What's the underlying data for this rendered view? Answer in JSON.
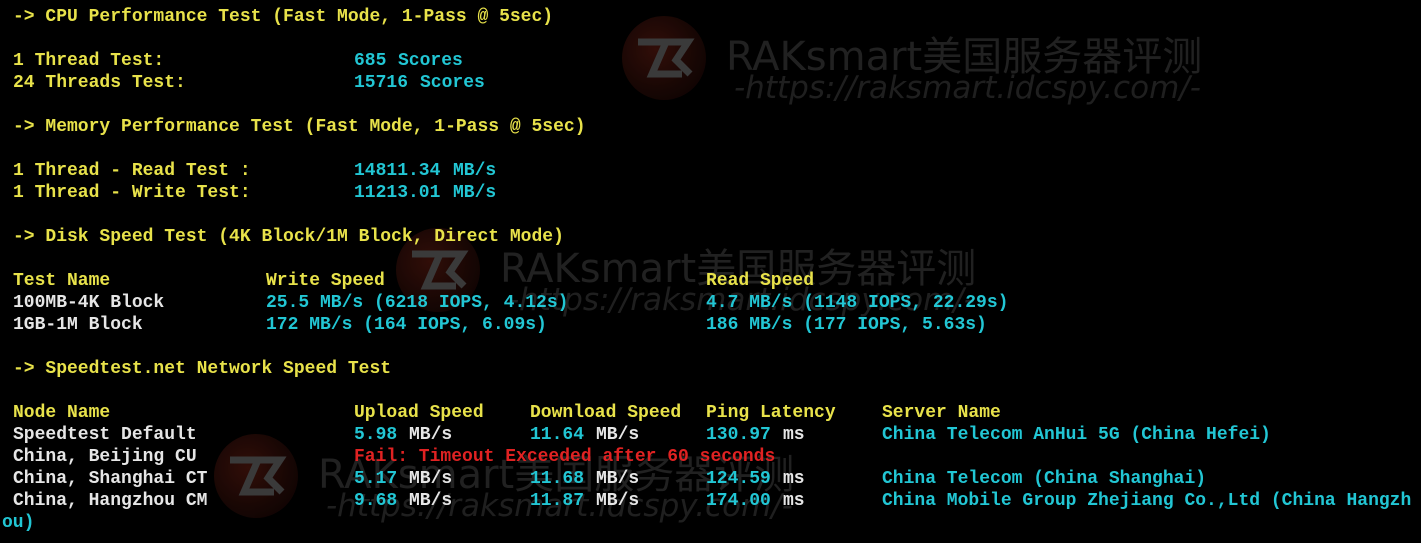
{
  "cpu": {
    "heading": "-> CPU Performance Test (Fast Mode, 1-Pass @ 5sec)",
    "rows": [
      {
        "label": "1 Thread Test:",
        "value": "685",
        "unit": "Scores"
      },
      {
        "label": "24 Threads Test:",
        "value": "15716",
        "unit": "Scores"
      }
    ]
  },
  "memory": {
    "heading": "-> Memory Performance Test (Fast Mode, 1-Pass @ 5sec)",
    "rows": [
      {
        "label": "1 Thread - Read Test :",
        "value": "14811.34",
        "unit": "MB/s"
      },
      {
        "label": "1 Thread - Write Test:",
        "value": "11213.01",
        "unit": "MB/s"
      }
    ]
  },
  "disk": {
    "heading": "-> Disk Speed Test (4K Block/1M Block, Direct Mode)",
    "headers": {
      "name": "Test Name",
      "write": "Write Speed",
      "read": "Read Speed"
    },
    "rows": [
      {
        "name": "100MB-4K Block",
        "write": "25.5 MB/s (6218 IOPS, 4.12s)",
        "read": "4.7 MB/s (1148 IOPS, 22.29s)"
      },
      {
        "name": "1GB-1M Block",
        "write": "172 MB/s (164 IOPS, 6.09s)",
        "read": "186 MB/s (177 IOPS, 5.63s)"
      }
    ]
  },
  "network": {
    "heading": "-> Speedtest.net Network Speed Test",
    "headers": {
      "node": "Node Name",
      "upload": "Upload Speed",
      "download": "Download Speed",
      "ping": "Ping Latency",
      "server": "Server Name"
    },
    "rows": [
      {
        "node": "Speedtest Default",
        "upload": "5.98",
        "upload_unit": "MB/s",
        "download": "11.64",
        "download_unit": "MB/s",
        "ping": "130.97",
        "ping_unit": "ms",
        "server": "China Telecom AnHui 5G (China Hefei)"
      },
      {
        "node": "China, Beijing CU",
        "error": "Fail: Timeout Exceeded after 60 seconds"
      },
      {
        "node": "China, Shanghai CT",
        "upload": "5.17",
        "upload_unit": "MB/s",
        "download": "11.68",
        "download_unit": "MB/s",
        "ping": "124.59",
        "ping_unit": "ms",
        "server": "China Telecom (China Shanghai)"
      },
      {
        "node": "China, Hangzhou CM",
        "upload": "9.68",
        "upload_unit": "MB/s",
        "download": "11.87",
        "download_unit": "MB/s",
        "ping": "174.00",
        "ping_unit": "ms",
        "server": "China Mobile Group Zhejiang Co.,Ltd (China Hangzh"
      }
    ],
    "wrap_line": "ou)"
  },
  "watermark": {
    "title": "RAKsmart美国服务器评测",
    "url": "-https://raksmart.idcspy.com/-"
  },
  "colors": {
    "background": "#000000",
    "heading": "#e8e24a",
    "label": "#e6e6e6",
    "value": "#22c6d4",
    "error": "#e02222"
  }
}
